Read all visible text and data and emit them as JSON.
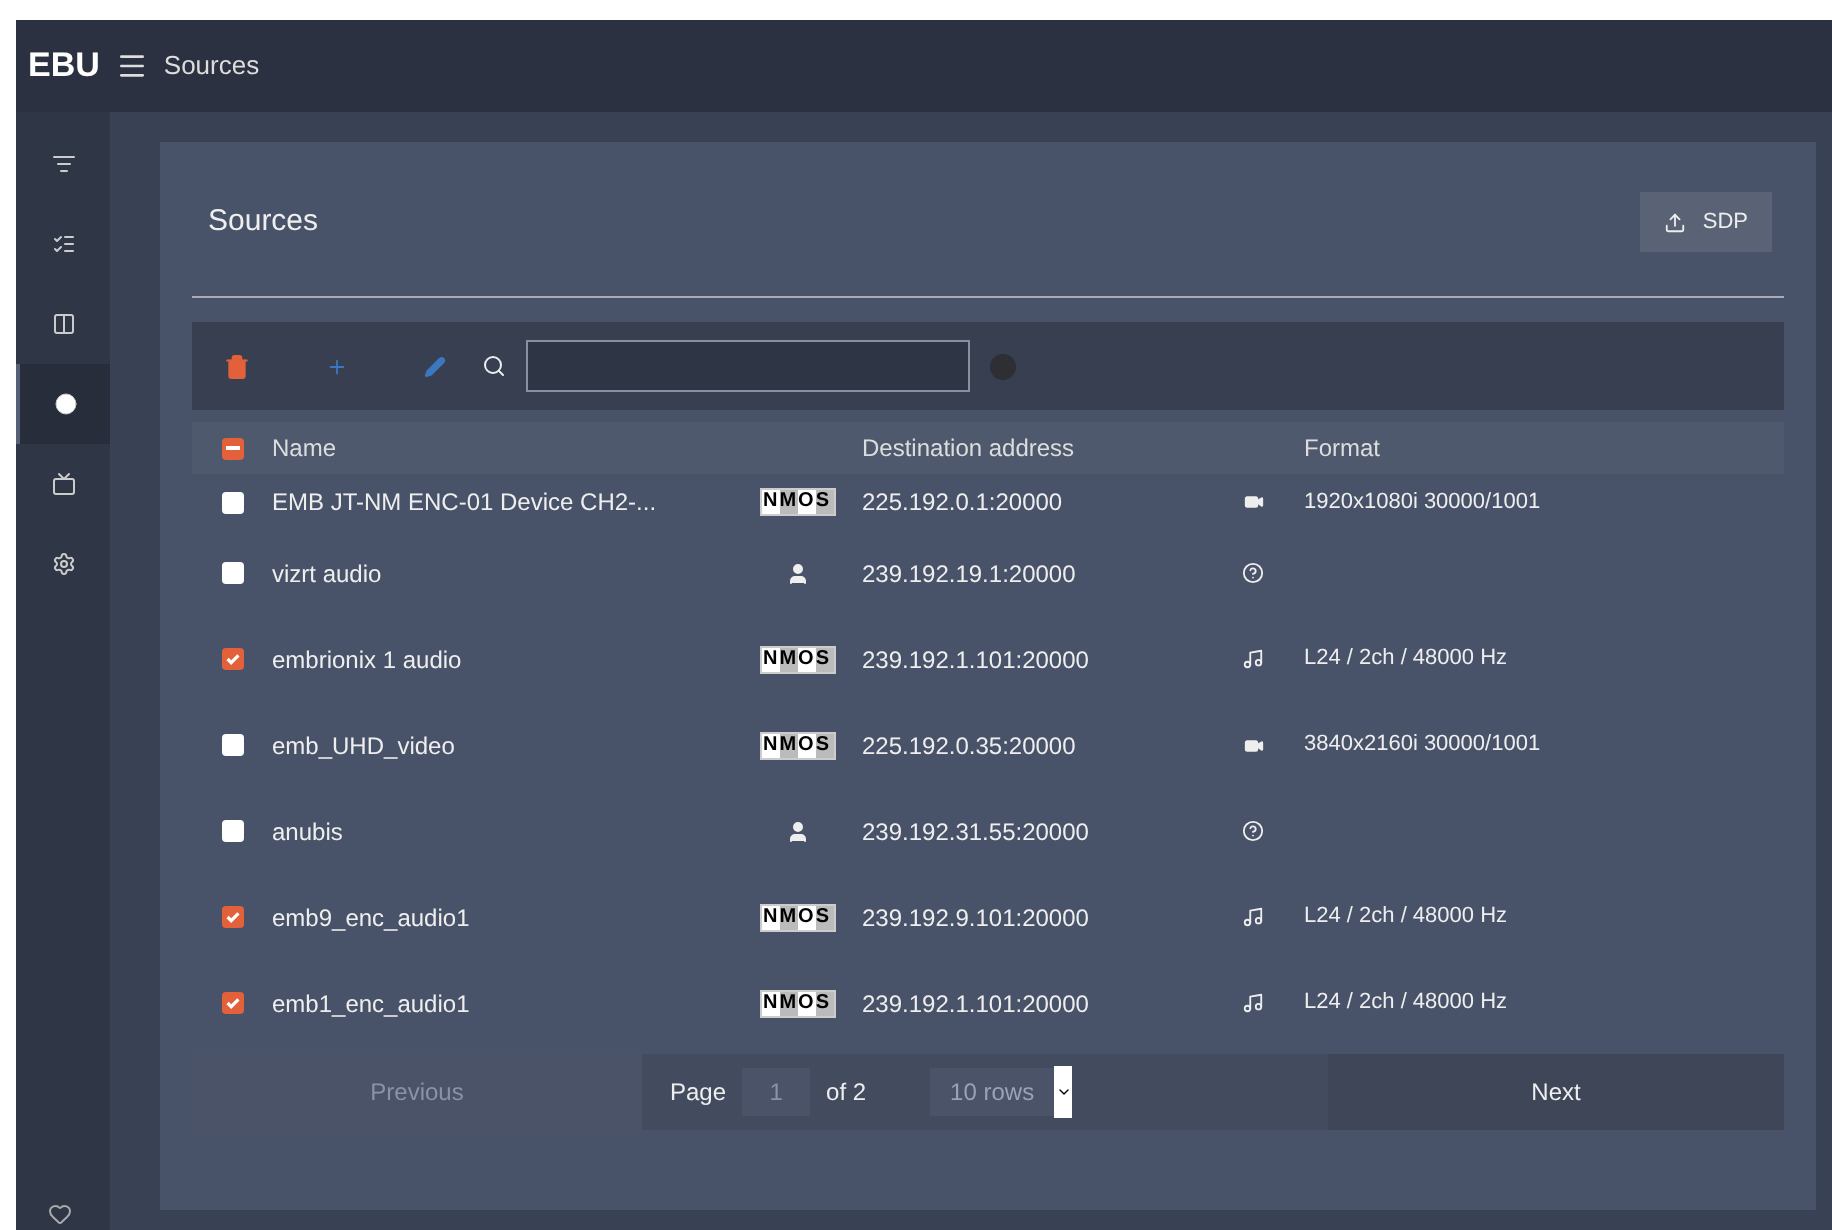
{
  "topbar": {
    "logo": "EBU",
    "title": "Sources"
  },
  "sidebar": {
    "items": [
      {
        "kind": "queue",
        "selected": false
      },
      {
        "kind": "checklist",
        "selected": false
      },
      {
        "kind": "swap",
        "selected": false
      },
      {
        "kind": "dot",
        "selected": true
      },
      {
        "kind": "tv",
        "selected": false
      },
      {
        "kind": "gear",
        "selected": false
      }
    ]
  },
  "panel": {
    "title": "Sources",
    "sdp_button": "SDP"
  },
  "table": {
    "header_checkbox": {
      "indeterminate": true
    },
    "columns": [
      "Name",
      "Destination address",
      "Format"
    ],
    "rows": [
      {
        "checked": false,
        "name": "EMB JT-NM ENC-01 Device CH2-...",
        "source": {
          "kind": "nmos",
          "label": "NMOS"
        },
        "address": "225.192.0.1:20000",
        "media": {
          "kind": "video"
        },
        "format": "1920x1080i 30000/1001"
      },
      {
        "checked": false,
        "name": "vizrt audio",
        "source": {
          "kind": "manual"
        },
        "address": "239.192.19.1:20000",
        "media": {
          "kind": "unknown"
        }
      },
      {
        "checked": true,
        "name": "embrionix 1 audio",
        "source": {
          "kind": "nmos",
          "label": "NMOS"
        },
        "address": "239.192.1.101:20000",
        "media": {
          "kind": "audio"
        },
        "format": "L24 / 2ch / 48000 Hz"
      },
      {
        "checked": false,
        "name": "emb_UHD_video",
        "source": {
          "kind": "nmos",
          "label": "NMOS"
        },
        "address": "225.192.0.35:20000",
        "media": {
          "kind": "video"
        },
        "format": "3840x2160i 30000/1001"
      },
      {
        "checked": false,
        "name": "anubis",
        "source": {
          "kind": "manual"
        },
        "address": "239.192.31.55:20000",
        "media": {
          "kind": "unknown"
        }
      },
      {
        "checked": true,
        "name": "emb9_enc_audio1",
        "source": {
          "kind": "nmos",
          "label": "NMOS"
        },
        "address": "239.192.9.101:20000",
        "media": {
          "kind": "audio"
        },
        "format": "L24 / 2ch / 48000 Hz"
      },
      {
        "checked": true,
        "name": "emb1_enc_audio1",
        "source": {
          "kind": "nmos",
          "label": "NMOS"
        },
        "address": "239.192.1.101:20000",
        "media": {
          "kind": "audio"
        },
        "format": "L24 / 2ch / 48000 Hz"
      }
    ]
  },
  "pagination": {
    "previous": "Previous",
    "page_label": "Page",
    "page": "1",
    "of": "of 2",
    "rows_select": "10 rows",
    "next": "Next"
  }
}
